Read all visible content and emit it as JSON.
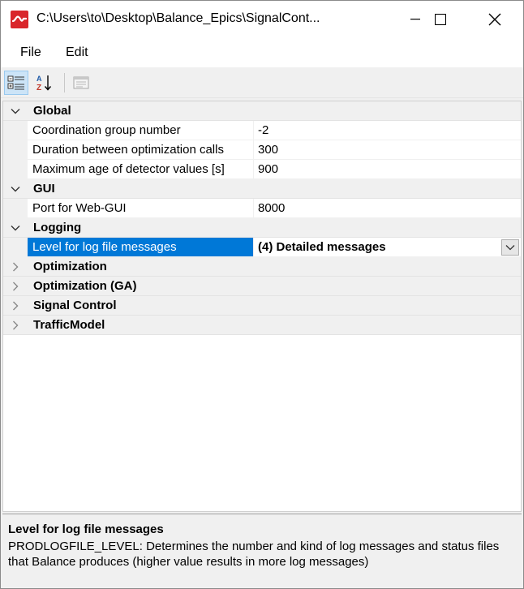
{
  "window": {
    "title": "C:\\Users\\to\\Desktop\\Balance_Epics\\SignalCont..."
  },
  "menu": {
    "file": "File",
    "edit": "Edit"
  },
  "grid": {
    "categories": {
      "global": "Global",
      "gui": "GUI",
      "logging": "Logging",
      "optimization": "Optimization",
      "optimization_ga": "Optimization (GA)",
      "signal_control": "Signal Control",
      "traffic_model": "TrafficModel"
    },
    "properties": {
      "coordination_group": {
        "name": "Coordination group number",
        "value": "-2"
      },
      "duration_between": {
        "name": "Duration between optimization calls",
        "value": "300"
      },
      "max_age": {
        "name": "Maximum age of detector values [s]",
        "value": "900"
      },
      "port_web_gui": {
        "name": "Port for Web-GUI",
        "value": "8000"
      },
      "log_level": {
        "name": "Level for log file messages",
        "value": "(4) Detailed messages"
      }
    }
  },
  "description": {
    "title": "Level for log file messages",
    "text": "PRODLOGFILE_LEVEL: Determines the number and kind of log messages and status files that Balance produces (higher value results in more log messages)"
  },
  "colors": {
    "selection": "#0078d7",
    "app_icon": "#d9262b"
  }
}
